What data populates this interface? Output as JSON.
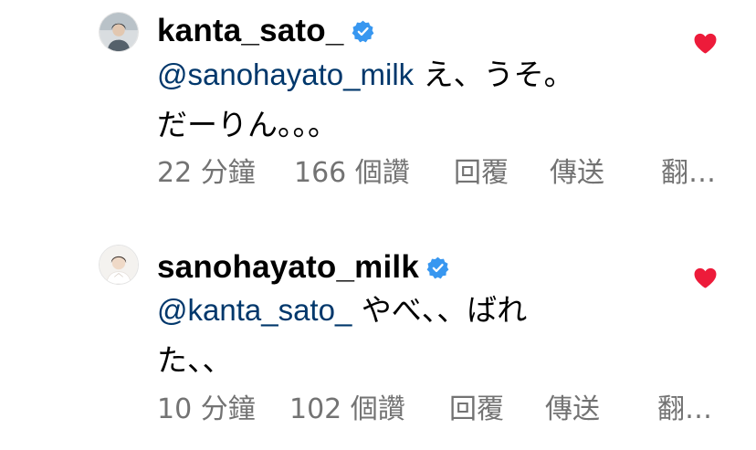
{
  "colors": {
    "mention": "#00376b",
    "meta": "#737373",
    "verified": "#3897f0",
    "heart": "#ed1b3a"
  },
  "comments": [
    {
      "username": "kanta_sato_",
      "verified": true,
      "avatar_icon": "avatar-photo-icon",
      "mention": "@sanohayato_milk",
      "text": " え、うそ。だーりん。。。",
      "time": "22 分鐘",
      "likes": "166 個讚",
      "reply": "回覆",
      "share": "傳送",
      "translate": "翻…",
      "liked": true
    },
    {
      "username": "sanohayato_milk",
      "verified": true,
      "avatar_icon": "avatar-photo-icon",
      "mention": "@kanta_sato_",
      "text": " やべ、、ばれた、、",
      "time": "10 分鐘",
      "likes": "102 個讚",
      "reply": "回覆",
      "share": "傳送",
      "translate": "翻…",
      "liked": true
    }
  ]
}
